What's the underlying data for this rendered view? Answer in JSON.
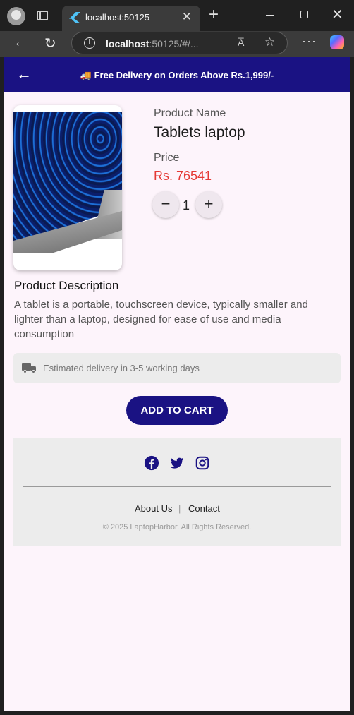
{
  "browser": {
    "tab_title": "localhost:50125",
    "url_host": "localhost",
    "url_rest": ":50125/#/...",
    "tab_close": "✕",
    "new_tab": "+",
    "win_close": "✕",
    "nav_back": "←",
    "nav_reload": "↻",
    "info": "i",
    "read_aloud": "A̅",
    "favorite": "☆",
    "more": "···"
  },
  "header": {
    "back": "←",
    "promo_icon": "🚚",
    "promo_text": "Free Delivery on Orders Above Rs.1,999/-"
  },
  "product": {
    "name_label": "Product Name",
    "name": "Tablets laptop",
    "price_label": "Price",
    "price": "Rs. 76541",
    "quantity": "1",
    "minus": "−",
    "plus": "+",
    "description_title": "Product Description",
    "description": "A tablet is a portable, touchscreen device, typically smaller and lighter than a laptop, designed for ease of use and media consumption"
  },
  "delivery": {
    "text": "Estimated delivery in 3-5 working days",
    "icon": "truck-icon"
  },
  "cart_button": "ADD TO CART",
  "footer": {
    "social_icons": [
      "facebook-icon",
      "twitter-icon",
      "instagram-icon"
    ],
    "about": "About Us",
    "separator": "|",
    "contact": "Contact",
    "copyright": "© 2025 LaptopHarbor. All Rights Reserved."
  },
  "colors": {
    "brand": "#1a1283",
    "price": "#e53935",
    "page_bg": "#fdf4fb",
    "panel_bg": "#ececec"
  }
}
